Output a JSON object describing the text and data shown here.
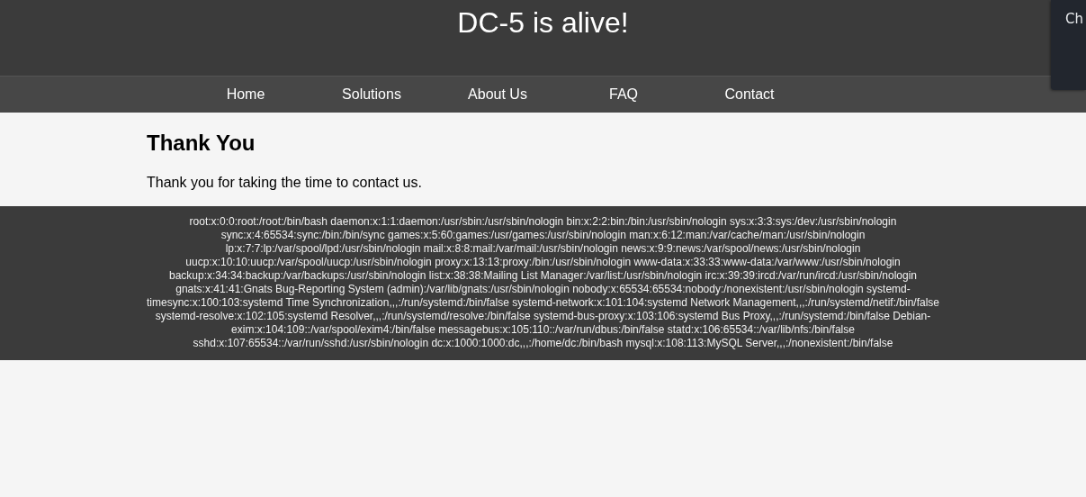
{
  "header": {
    "title": "DC-5 is alive!"
  },
  "nav": {
    "items": [
      {
        "label": "Home"
      },
      {
        "label": "Solutions"
      },
      {
        "label": "About Us"
      },
      {
        "label": "FAQ"
      },
      {
        "label": "Contact"
      }
    ]
  },
  "content": {
    "heading": "Thank You",
    "text": "Thank you for taking the time to contact us."
  },
  "footer": {
    "lines": [
      "root:x:0:0:root:/root:/bin/bash daemon:x:1:1:daemon:/usr/sbin:/usr/sbin/nologin bin:x:2:2:bin:/bin:/usr/sbin/nologin sys:x:3:3:sys:/dev:/usr/sbin/nologin",
      "sync:x:4:65534:sync:/bin:/bin/sync games:x:5:60:games:/usr/games:/usr/sbin/nologin man:x:6:12:man:/var/cache/man:/usr/sbin/nologin",
      "lp:x:7:7:lp:/var/spool/lpd:/usr/sbin/nologin mail:x:8:8:mail:/var/mail:/usr/sbin/nologin news:x:9:9:news:/var/spool/news:/usr/sbin/nologin",
      "uucp:x:10:10:uucp:/var/spool/uucp:/usr/sbin/nologin proxy:x:13:13:proxy:/bin:/usr/sbin/nologin www-data:x:33:33:www-data:/var/www:/usr/sbin/nologin",
      "backup:x:34:34:backup:/var/backups:/usr/sbin/nologin list:x:38:38:Mailing List Manager:/var/list:/usr/sbin/nologin irc:x:39:39:ircd:/var/run/ircd:/usr/sbin/nologin",
      "gnats:x:41:41:Gnats Bug-Reporting System (admin):/var/lib/gnats:/usr/sbin/nologin nobody:x:65534:65534:nobody:/nonexistent:/usr/sbin/nologin systemd-",
      "timesync:x:100:103:systemd Time Synchronization,,,:/run/systemd:/bin/false systemd-network:x:101:104:systemd Network Management,,,:/run/systemd/netif:/bin/false",
      "systemd-resolve:x:102:105:systemd Resolver,,,:/run/systemd/resolve:/bin/false systemd-bus-proxy:x:103:106:systemd Bus Proxy,,,:/run/systemd:/bin/false Debian-",
      "exim:x:104:109::/var/spool/exim4:/bin/false messagebus:x:105:110::/var/run/dbus:/bin/false statd:x:106:65534::/var/lib/nfs:/bin/false",
      "sshd:x:107:65534::/var/run/sshd:/usr/sbin/nologin dc:x:1000:1000:dc,,,:/home/dc:/bin/bash mysql:x:108:113:MySQL Server,,,:/nonexistent:/bin/false"
    ]
  },
  "popup": {
    "text": "Ch"
  }
}
